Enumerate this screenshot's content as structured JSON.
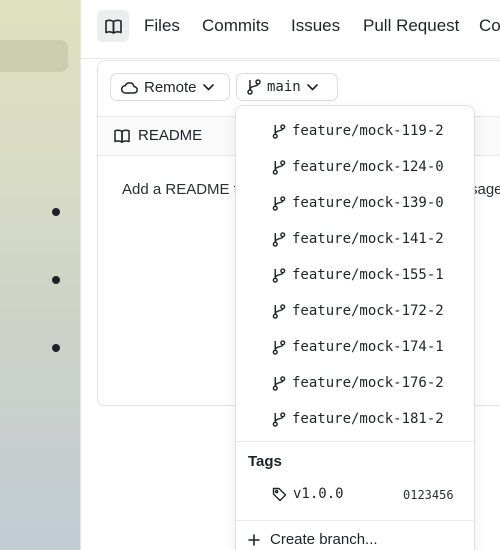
{
  "nav": {
    "tabs": [
      "Files",
      "Commits",
      "Issues",
      "Pull Request",
      "Co"
    ]
  },
  "toolbar": {
    "remote_label": "Remote",
    "branch_label": "main"
  },
  "readme": {
    "title": "README",
    "message_start": "Add a README to",
    "message_end": "sage"
  },
  "branches": [
    "feature/mock-119-2",
    "feature/mock-124-0",
    "feature/mock-139-0",
    "feature/mock-141-2",
    "feature/mock-155-1",
    "feature/mock-172-2",
    "feature/mock-174-1",
    "feature/mock-176-2",
    "feature/mock-181-2"
  ],
  "tags": {
    "heading": "Tags",
    "items": [
      {
        "name": "v1.0.0",
        "hash": "0123456"
      }
    ]
  },
  "create_branch_label": "Create branch..."
}
